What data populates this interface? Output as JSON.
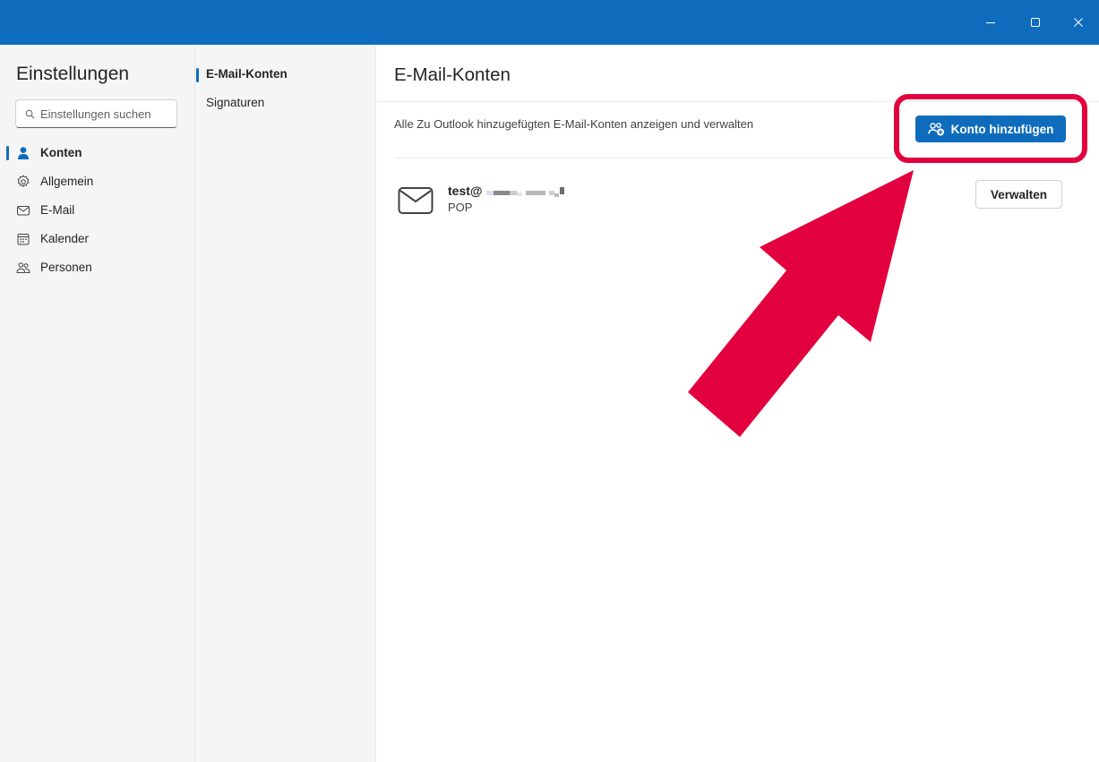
{
  "settings": {
    "title": "Einstellungen",
    "search_placeholder": "Einstellungen suchen"
  },
  "sidebar": {
    "items": [
      {
        "label": "Konten",
        "icon": "person-icon",
        "active": true
      },
      {
        "label": "Allgemein",
        "icon": "gear-icon",
        "active": false
      },
      {
        "label": "E-Mail",
        "icon": "mail-icon",
        "active": false
      },
      {
        "label": "Kalender",
        "icon": "calendar-icon",
        "active": false
      },
      {
        "label": "Personen",
        "icon": "people-icon",
        "active": false
      }
    ]
  },
  "subnav": {
    "items": [
      {
        "label": "E-Mail-Konten",
        "active": true
      },
      {
        "label": "Signaturen",
        "active": false
      }
    ]
  },
  "main": {
    "title": "E-Mail-Konten",
    "subtitle": "Alle Zu Outlook hinzugefügten E-Mail-Konten anzeigen und verwalten",
    "add_account_label": "Konto hinzufügen",
    "account": {
      "email_visible": "test@",
      "type": "POP",
      "manage_label": "Verwalten"
    }
  },
  "colors": {
    "accent": "#0f6cbd",
    "annotation": "#e2003e",
    "sidebar_bg": "#f5f5f5"
  }
}
